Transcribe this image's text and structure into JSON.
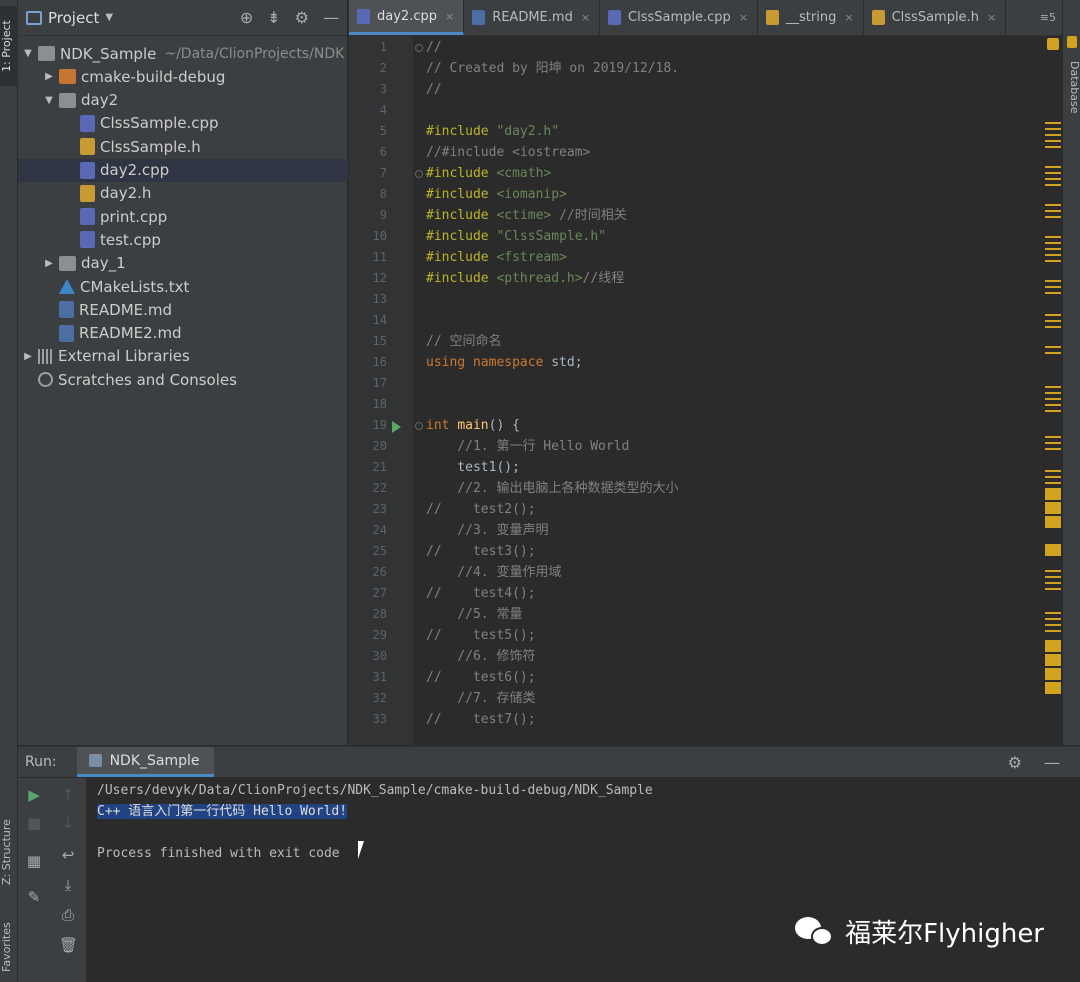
{
  "left_strip": {
    "project_tab": "1: Project",
    "structure_tab": "Z: Structure",
    "favorites_tab": "Favorites"
  },
  "right_strip": {
    "database_tab": "Database"
  },
  "project_panel": {
    "title": "Project",
    "tree": [
      {
        "label": "NDK_Sample",
        "path": "~/Data/ClionProjects/NDK",
        "icon": "folder-icon",
        "arrow": "▼",
        "indent": 0
      },
      {
        "label": "cmake-build-debug",
        "icon": "folder-icon",
        "arrow": "▶",
        "indent": 1,
        "accent": "#c57633"
      },
      {
        "label": "day2",
        "icon": "folder-icon",
        "arrow": "▼",
        "indent": 1
      },
      {
        "label": "ClssSample.cpp",
        "icon": "cpp-file-icon",
        "indent": 2
      },
      {
        "label": "ClssSample.h",
        "icon": "h-file-icon",
        "indent": 2
      },
      {
        "label": "day2.cpp",
        "icon": "cpp-file-icon",
        "indent": 2,
        "selected": true
      },
      {
        "label": "day2.h",
        "icon": "h-file-icon",
        "indent": 2
      },
      {
        "label": "print.cpp",
        "icon": "cpp-file-icon",
        "indent": 2
      },
      {
        "label": "test.cpp",
        "icon": "cpp-file-icon",
        "indent": 2
      },
      {
        "label": "day_1",
        "icon": "folder-icon",
        "arrow": "▶",
        "indent": 1
      },
      {
        "label": "CMakeLists.txt",
        "icon": "cmake-icon",
        "indent": 1
      },
      {
        "label": "README.md",
        "icon": "md-file-icon",
        "indent": 1
      },
      {
        "label": "README2.md",
        "icon": "md-file-icon",
        "indent": 1
      },
      {
        "label": "External Libraries",
        "icon": "library-icon",
        "arrow": "▶",
        "indent": 0
      },
      {
        "label": "Scratches and Consoles",
        "icon": "scratch-icon",
        "indent": 0
      }
    ]
  },
  "editor_tabs": [
    {
      "label": "day2.cpp",
      "active": true,
      "color": "#5969b5"
    },
    {
      "label": "README.md",
      "color": "#4c6ea3"
    },
    {
      "label": "ClssSample.cpp",
      "color": "#5969b5"
    },
    {
      "label": "__string",
      "color": "#c79a34"
    },
    {
      "label": "ClssSample.h",
      "color": "#c79a34"
    }
  ],
  "tab_overflow": "≡5",
  "code_lines": [
    [
      [
        "c-com",
        "//"
      ]
    ],
    [
      [
        "c-com",
        "// Created by 阳坤 on 2019/12/18."
      ]
    ],
    [
      [
        "c-com",
        "//"
      ]
    ],
    [],
    [
      [
        "c-pp",
        "#include "
      ],
      [
        "c-str",
        "\"day2.h\""
      ]
    ],
    [
      [
        "c-com",
        "//#include <iostream>"
      ]
    ],
    [
      [
        "c-pp",
        "#include "
      ],
      [
        "c-str",
        "<cmath>"
      ]
    ],
    [
      [
        "c-pp",
        "#include "
      ],
      [
        "c-str",
        "<iomanip>"
      ]
    ],
    [
      [
        "c-pp",
        "#include "
      ],
      [
        "c-str",
        "<ctime>"
      ],
      [
        "c-com",
        " //时间相关"
      ]
    ],
    [
      [
        "c-pp",
        "#include "
      ],
      [
        "c-str",
        "\"ClssSample.h\""
      ]
    ],
    [
      [
        "c-pp",
        "#include "
      ],
      [
        "c-str",
        "<fstream>"
      ]
    ],
    [
      [
        "c-pp",
        "#include "
      ],
      [
        "c-str",
        "<pthread.h>"
      ],
      [
        "c-com",
        "//线程"
      ]
    ],
    [],
    [],
    [
      [
        "c-com",
        "// 空间命名"
      ]
    ],
    [
      [
        "c-kw",
        "using namespace "
      ],
      [
        "",
        "std;"
      ]
    ],
    [],
    [],
    [
      [
        "c-kw",
        "int "
      ],
      [
        "c-fn",
        "main"
      ],
      [
        "",
        "() {"
      ]
    ],
    [
      [
        "c-com",
        "    //1. 第一行 Hello World"
      ]
    ],
    [
      [
        "",
        "    test1();"
      ]
    ],
    [
      [
        "c-com",
        "    //2. 输出电脑上各种数据类型的大小"
      ]
    ],
    [
      [
        "c-com",
        "//    test2();"
      ]
    ],
    [
      [
        "c-com",
        "    //3. 变量声明"
      ]
    ],
    [
      [
        "c-com",
        "//    test3();"
      ]
    ],
    [
      [
        "c-com",
        "    //4. 变量作用域"
      ]
    ],
    [
      [
        "c-com",
        "//    test4();"
      ]
    ],
    [
      [
        "c-com",
        "    //5. 常量"
      ]
    ],
    [
      [
        "c-com",
        "//    test5();"
      ]
    ],
    [
      [
        "c-com",
        "    //6. 修饰符"
      ]
    ],
    [
      [
        "c-com",
        "//    test6();"
      ]
    ],
    [
      [
        "c-com",
        "    //7. 存储类"
      ]
    ],
    [
      [
        "c-com",
        "//    test7();"
      ]
    ]
  ],
  "run_panel": {
    "label": "Run:",
    "tab": "NDK_Sample",
    "console": [
      {
        "text": "/Users/devyk/Data/ClionProjects/NDK_Sample/cmake-build-debug/NDK_Sample",
        "selected": false
      },
      {
        "text": "C++ 语言入门第一行代码 Hello World!",
        "selected": true
      },
      {
        "text": "",
        "selected": false
      },
      {
        "text": "Process finished with exit code ",
        "selected": false
      }
    ]
  },
  "watermark": {
    "text": "福莱尔Flyhigher"
  }
}
